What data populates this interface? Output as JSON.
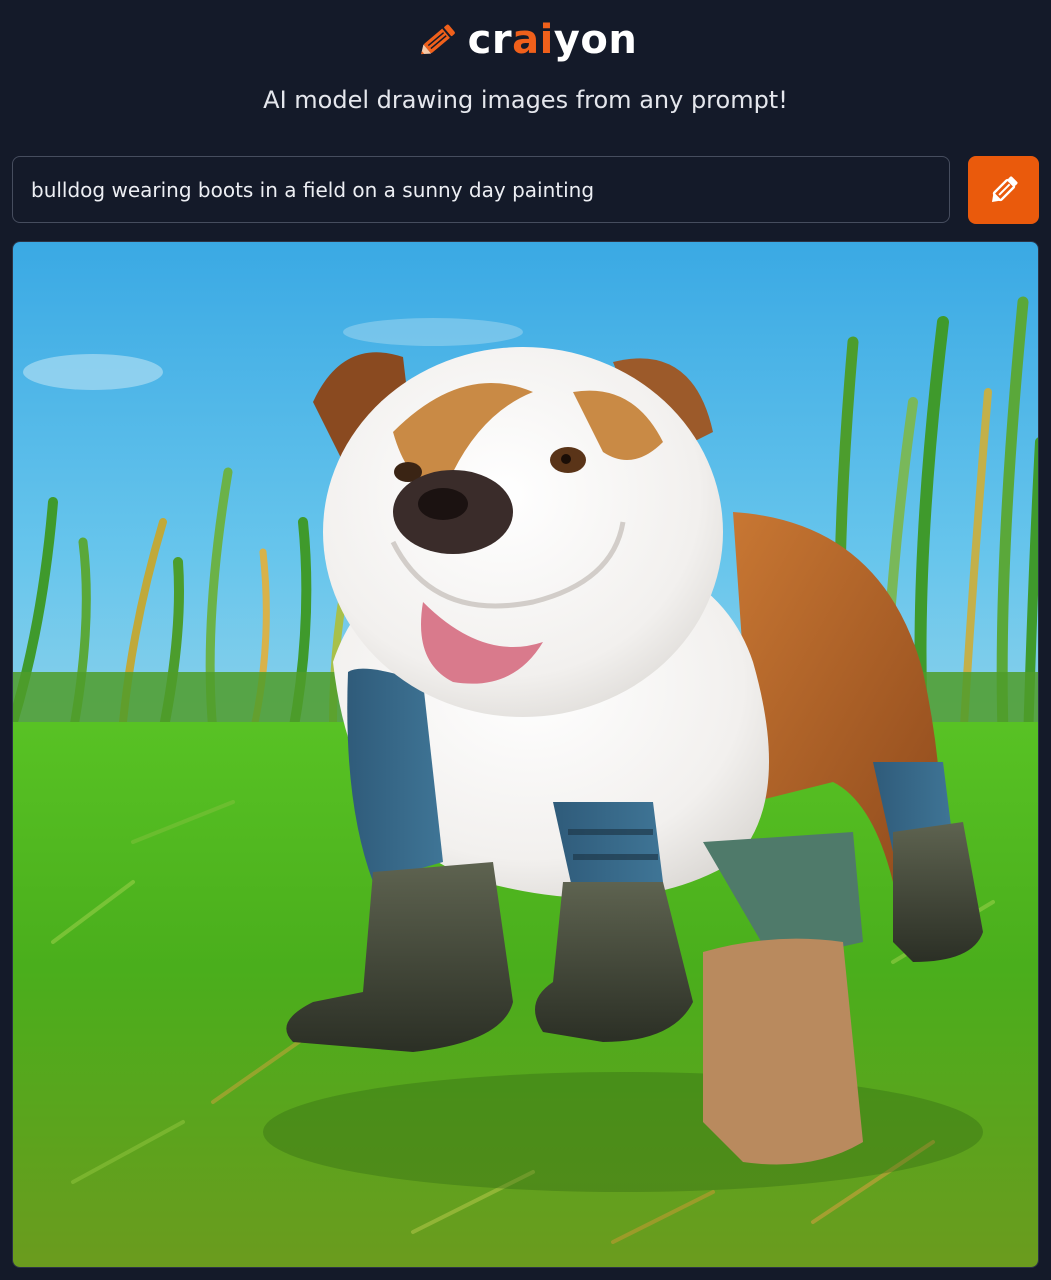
{
  "header": {
    "logo_icon": "pencil-icon",
    "logo_text_start": "cr",
    "logo_text_accent": "ai",
    "logo_text_end": "yon",
    "tagline": "AI model drawing images from any prompt!"
  },
  "prompt": {
    "value": "bulldog wearing boots in a field on a sunny day painting",
    "placeholder": ""
  },
  "draw_button": {
    "icon": "pencil-icon",
    "aria_label": "Draw"
  },
  "result": {
    "image": "generated-image",
    "alt": "bulldog wearing boots in a field on a sunny day painting"
  },
  "colors": {
    "background": "#141a29",
    "accent": "#ea5a0c",
    "input_border": "#464d5e",
    "text": "#e8eaef"
  }
}
